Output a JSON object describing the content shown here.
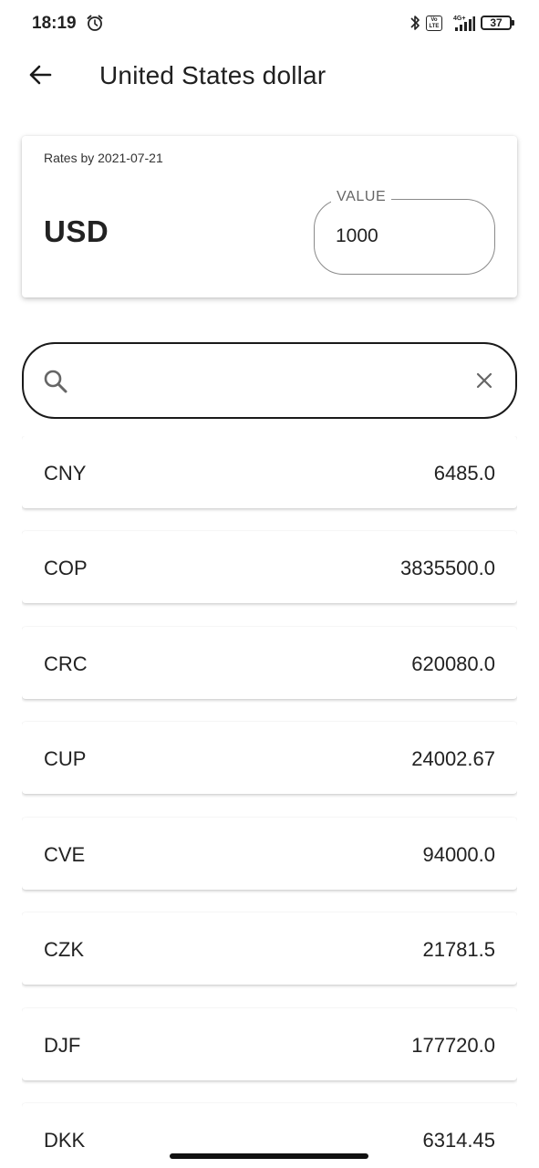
{
  "status_bar": {
    "time": "18:19",
    "network": "4G+",
    "volte": "Vo LTE",
    "battery": "37"
  },
  "app_bar": {
    "title": "United States dollar"
  },
  "base_card": {
    "rates_date": "Rates by 2021-07-21",
    "currency_code": "USD",
    "value_label": "VALUE",
    "value": "1000"
  },
  "search": {
    "value": "",
    "placeholder": ""
  },
  "rates": [
    {
      "code": "CNY",
      "value": "6485.0"
    },
    {
      "code": "COP",
      "value": "3835500.0"
    },
    {
      "code": "CRC",
      "value": "620080.0"
    },
    {
      "code": "CUP",
      "value": "24002.67"
    },
    {
      "code": "CVE",
      "value": "94000.0"
    },
    {
      "code": "CZK",
      "value": "21781.5"
    },
    {
      "code": "DJF",
      "value": "177720.0"
    },
    {
      "code": "DKK",
      "value": "6314.45"
    }
  ]
}
